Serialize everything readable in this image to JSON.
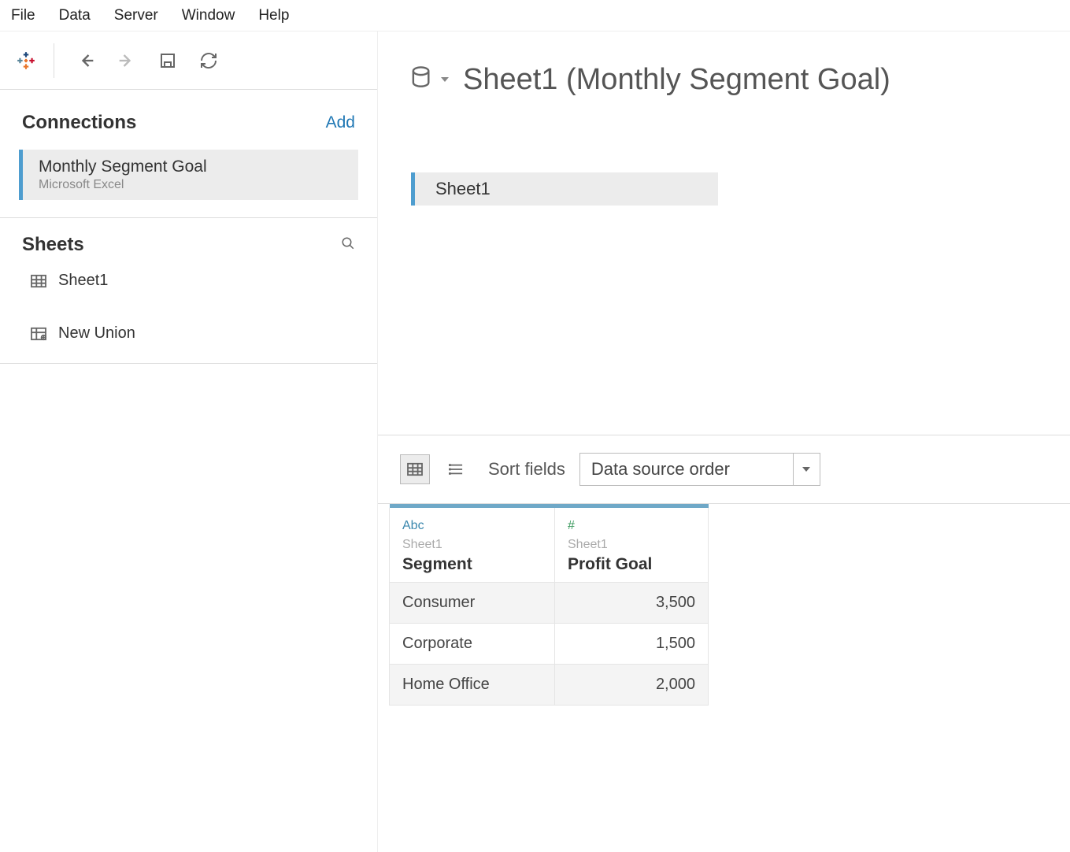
{
  "menubar": [
    "File",
    "Data",
    "Server",
    "Window",
    "Help"
  ],
  "left": {
    "connections_title": "Connections",
    "add_label": "Add",
    "connection": {
      "name": "Monthly Segment Goal",
      "type": "Microsoft Excel"
    },
    "sheets_title": "Sheets",
    "sheet_item": "Sheet1",
    "union_item": "New Union"
  },
  "right": {
    "title": "Sheet1 (Monthly Segment Goal)",
    "canvas_sheet": "Sheet1",
    "sort_label": "Sort fields",
    "sort_value": "Data source order"
  },
  "grid": {
    "columns": [
      {
        "type": "Abc",
        "source": "Sheet1",
        "name": "Segment"
      },
      {
        "type": "#",
        "source": "Sheet1",
        "name": "Profit Goal"
      }
    ],
    "rows": [
      {
        "segment": "Consumer",
        "profit_goal": "3,500"
      },
      {
        "segment": "Corporate",
        "profit_goal": "1,500"
      },
      {
        "segment": "Home Office",
        "profit_goal": "2,000"
      }
    ]
  }
}
